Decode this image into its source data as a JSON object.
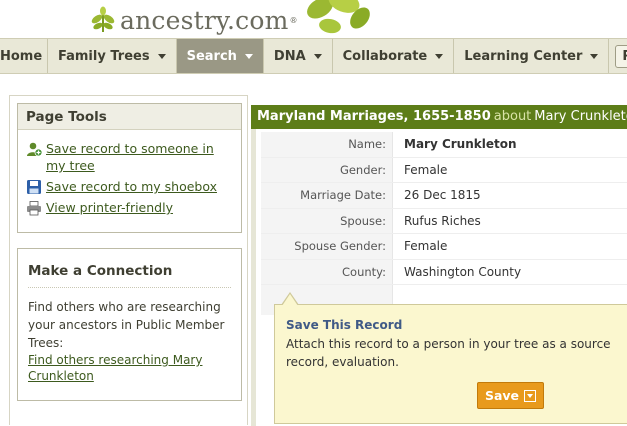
{
  "logo": {
    "text": "ancestry.com",
    "tm": "®"
  },
  "nav": {
    "items": [
      {
        "label": "Home",
        "dropdown": false
      },
      {
        "label": "Family Trees",
        "dropdown": true
      },
      {
        "label": "Search",
        "dropdown": true,
        "active": true
      },
      {
        "label": "DNA",
        "dropdown": true
      },
      {
        "label": "Collaborate",
        "dropdown": true
      },
      {
        "label": "Learning Center",
        "dropdown": true
      }
    ],
    "publish": "Publish"
  },
  "page_tools": {
    "title": "Page Tools",
    "items": [
      {
        "icon": "add-person-icon",
        "label": "Save record to someone in my tree"
      },
      {
        "icon": "save-disk-icon",
        "label": "Save record to my shoebox"
      },
      {
        "icon": "printer-icon",
        "label": "View printer-friendly"
      }
    ]
  },
  "connection": {
    "title": "Make a Connection",
    "text": "Find others who are researching your ancestors in Public Member Trees:",
    "link": "Find others researching Mary Crunkleton"
  },
  "record": {
    "collection": "Maryland Marriages, 1655-1850",
    "about": "about",
    "person": "Mary Crunkleton",
    "rows": [
      {
        "label": "Name:",
        "value": "Mary Crunkleton"
      },
      {
        "label": "Gender:",
        "value": "Female"
      },
      {
        "label": "Marriage Date:",
        "value": "26 Dec 1815"
      },
      {
        "label": "Spouse:",
        "value": "Rufus Riches"
      },
      {
        "label": "Spouse Gender:",
        "value": "Female"
      },
      {
        "label": "County:",
        "value": "Washington County"
      }
    ]
  },
  "save_tip": {
    "title": "Save This Record",
    "text": "Attach this record to a person in your tree as a source record, evaluation.",
    "button": "Save"
  },
  "colors": {
    "nav_bg": "#e9e8d7",
    "nav_active": "#9a9885",
    "record_header": "#5d7d18",
    "tip_bg": "#fbf7cf",
    "save_button": "#e89a1c",
    "link": "#3d5a1e"
  }
}
